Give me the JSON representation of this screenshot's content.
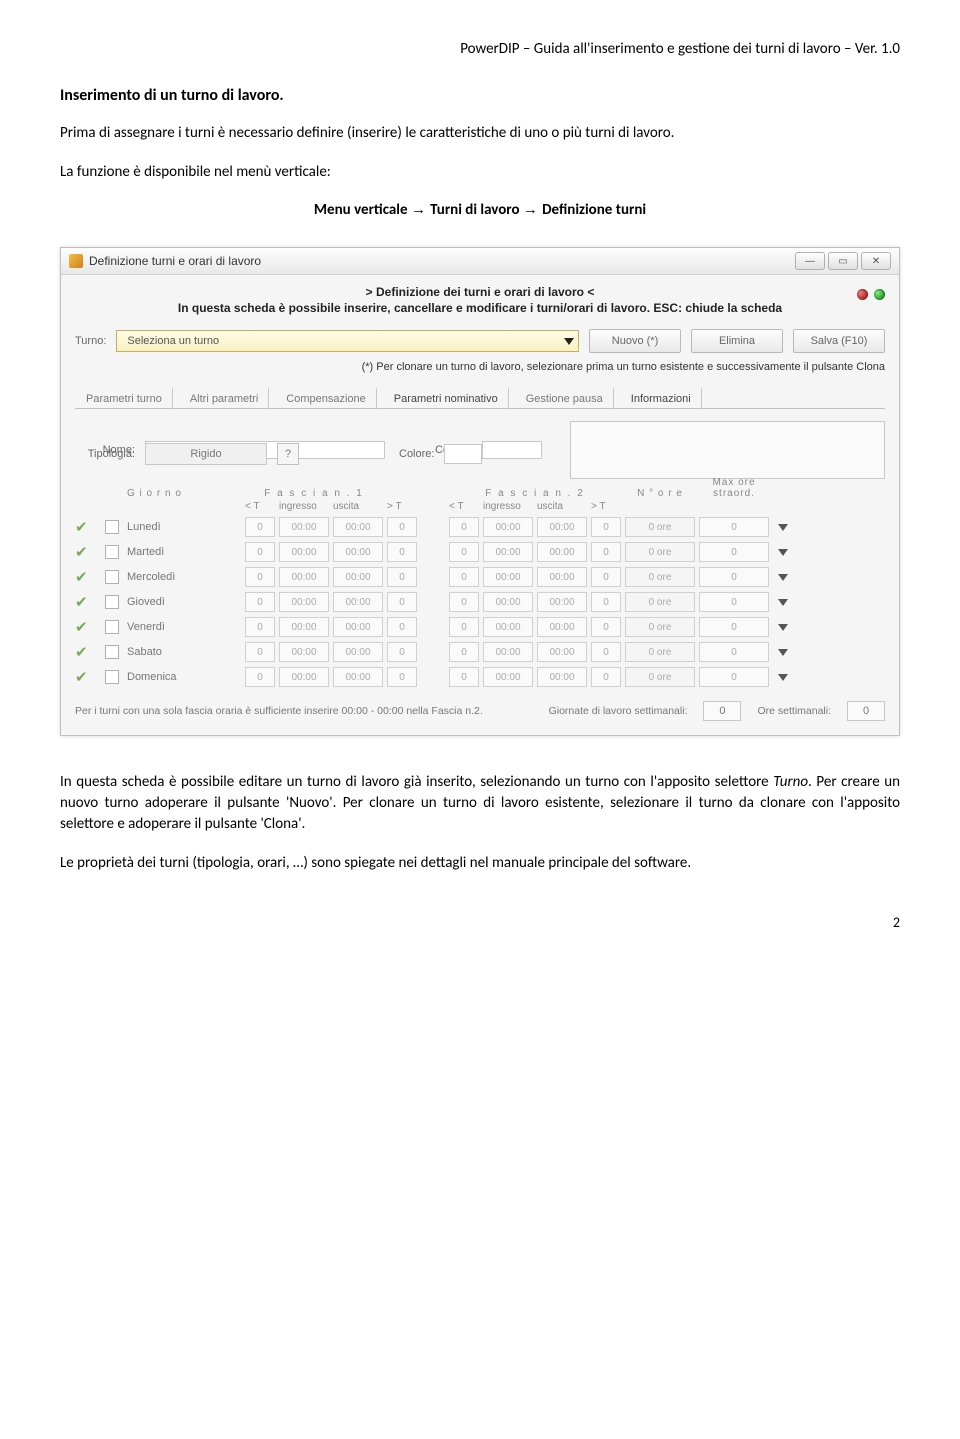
{
  "doc": {
    "header": "PowerDIP – Guida all'inserimento e gestione dei turni di lavoro – Ver. 1.0",
    "section_title": "Inserimento di un turno di lavoro.",
    "para1": "Prima di assegnare i turni è necessario definire (inserire) le caratteristiche di uno o più turni di lavoro.",
    "para2": "La funzione è disponibile nel menù verticale:",
    "menu_path": {
      "a": "Menu verticale",
      "b": "Turni di lavoro",
      "c": "Definizione turni"
    },
    "para3_pre": "In questa scheda è possibile editare un turno di lavoro già inserito, selezionando un turno con l'apposito selettore ",
    "para3_t": "Turno",
    "para3_mid": ". Per creare un nuovo turno adoperare il pulsante '",
    "para3_n": "Nuovo",
    "para3_mid2": "'. Per clonare un turno di lavoro esistente, selezionare il turno da clonare con l'apposito selettore e adoperare il pulsante '",
    "para3_c": "Clona",
    "para3_end": "'.",
    "para4": "Le proprietà dei turni (tipologia, orari, …) sono spiegate nei dettagli nel manuale principale del software.",
    "page_num": "2"
  },
  "win": {
    "title": "Definizione turni e orari di lavoro",
    "hdr1": "> Definizione dei turni e orari di lavoro <",
    "hdr2": "In questa scheda è possibile inserire, cancellare e modificare i turni/orari di lavoro. ESC: chiude la scheda",
    "turno_label": "Turno:",
    "turno_placeholder": "Seleziona un turno",
    "btn_nuovo": "Nuovo (*)",
    "btn_elimina": "Elimina",
    "btn_salva": "Salva (F10)",
    "hint": "(*) Per clonare un turno di lavoro, selezionare prima un turno esistente e successivamente il pulsante Clona",
    "tabs": [
      "Parametri turno",
      "Altri parametri",
      "Compensazione",
      "Parametri nominativo",
      "Gestione pausa",
      "Informazioni"
    ],
    "lbl_nome": "Nome:",
    "lbl_codice": "Codice:",
    "lbl_tipologia": "Tipologia:",
    "val_tipologia": "Rigido",
    "tiny_q": "?",
    "lbl_colore": "Colore:",
    "col_giorno": "G i o r n o",
    "col_f1": "F a s c i a   n . 1",
    "col_f2": "F a s c i a   n . 2",
    "col_nore": "N °   o r e",
    "col_max": "Max ore straord.",
    "sub_lt": "< T",
    "sub_ing": "ingresso",
    "sub_usc": "uscita",
    "sub_gt": "> T",
    "days": [
      "Lunedì",
      "Martedì",
      "Mercoledì",
      "Giovedì",
      "Venerdì",
      "Sabato",
      "Domenica"
    ],
    "ore_text": "0 ore",
    "zero": "0",
    "time": "00:00",
    "footer_left": "Per i turni con una sola fascia oraria è sufficiente inserire 00:00 - 00:00 nella Fascia n.2.",
    "footer_mid": "Giornate di lavoro settimanali:",
    "footer_right": "Ore settimanali:",
    "footer_val": "0"
  }
}
